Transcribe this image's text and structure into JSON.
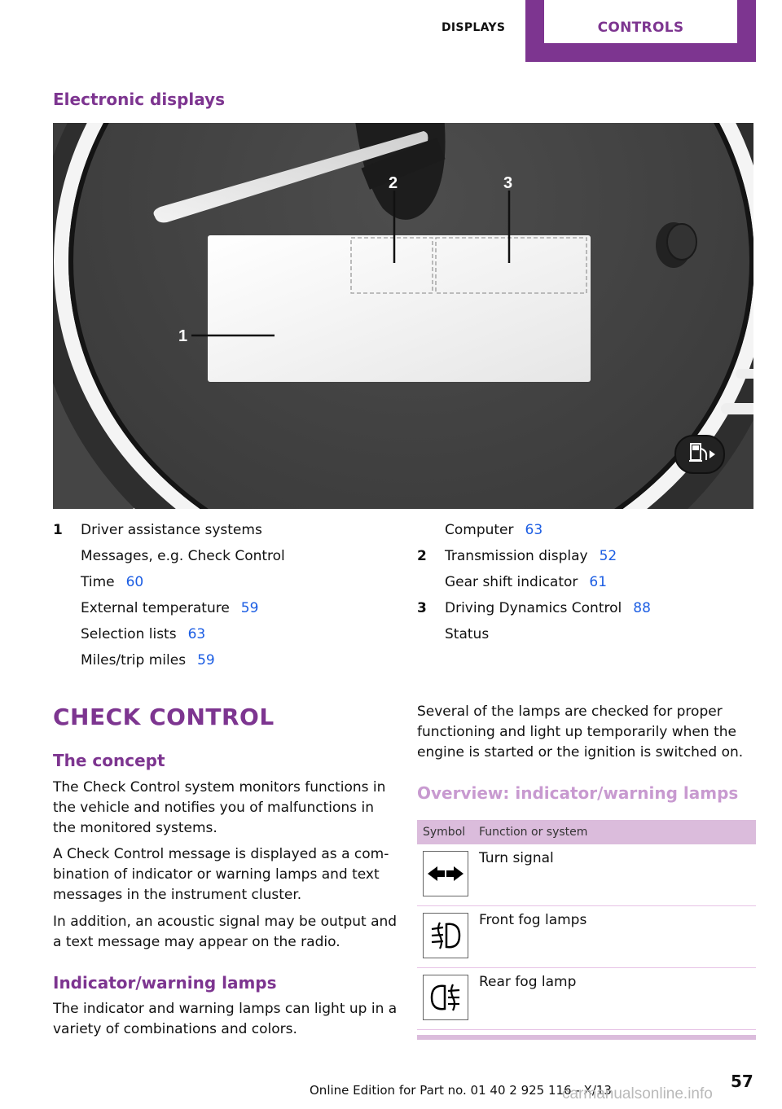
{
  "header": {
    "section_left": "DISPLAYS",
    "section_right": "CONTROLS",
    "accent_color": "#7d3590"
  },
  "figure": {
    "title": "Electronic displays",
    "callouts": [
      "1",
      "2",
      "3"
    ],
    "icons": [
      "speedometer-needle",
      "fuel-pump-icon"
    ]
  },
  "legend": {
    "left": [
      {
        "num": "1",
        "text": "Driver assistance systems",
        "page": ""
      },
      {
        "num": "",
        "text": "Messages, e.g. Check Control",
        "page": ""
      },
      {
        "num": "",
        "text": "Time",
        "page": "60"
      },
      {
        "num": "",
        "text": "External temperature",
        "page": "59"
      },
      {
        "num": "",
        "text": "Selection lists",
        "page": "63"
      },
      {
        "num": "",
        "text": "Miles/trip miles",
        "page": "59"
      }
    ],
    "right": [
      {
        "num": "",
        "text": "Computer",
        "page": "63"
      },
      {
        "num": "2",
        "text": "Transmission display",
        "page": "52"
      },
      {
        "num": "",
        "text": "Gear shift indicator",
        "page": "61"
      },
      {
        "num": "3",
        "text": "Driving Dynamics Control",
        "page": "88"
      },
      {
        "num": "",
        "text": "Status",
        "page": ""
      }
    ]
  },
  "check_control": {
    "title": "CHECK CONTROL",
    "concept_heading": "The concept",
    "concept_p1": "The Check Control system monitors functions in the vehicle and notifies you of malfunctions in the monitored systems.",
    "concept_p2": "A Check Control message is displayed as a com­bination of indicator or warning lamps and text messages in the instrument cluster.",
    "concept_p3": "In addition, an acoustic signal may be output and a text message may appear on the radio.",
    "lamps_heading": "Indicator/warning lamps",
    "lamps_p1": "The indicator and warning lamps can light up in a variety of combinations and colors.",
    "lamps_p2": "Several of the lamps are checked for proper functioning and light up temporarily when the engine is started or the ignition is switched on.",
    "overview_heading": "Overview: indicator/warning lamps"
  },
  "lamp_table": {
    "headers": [
      "Symbol",
      "Function or system"
    ],
    "rows": [
      {
        "icon": "turn-signal-icon",
        "label": "Turn signal"
      },
      {
        "icon": "front-fog-lamp-icon",
        "label": "Front fog lamps"
      },
      {
        "icon": "rear-fog-lamp-icon",
        "label": "Rear fog lamp"
      }
    ]
  },
  "footer": {
    "edition": "Online Edition for Part no. 01 40 2 925 116 - X/13",
    "page_number": "57",
    "watermark": "carmanualsonline.info"
  }
}
